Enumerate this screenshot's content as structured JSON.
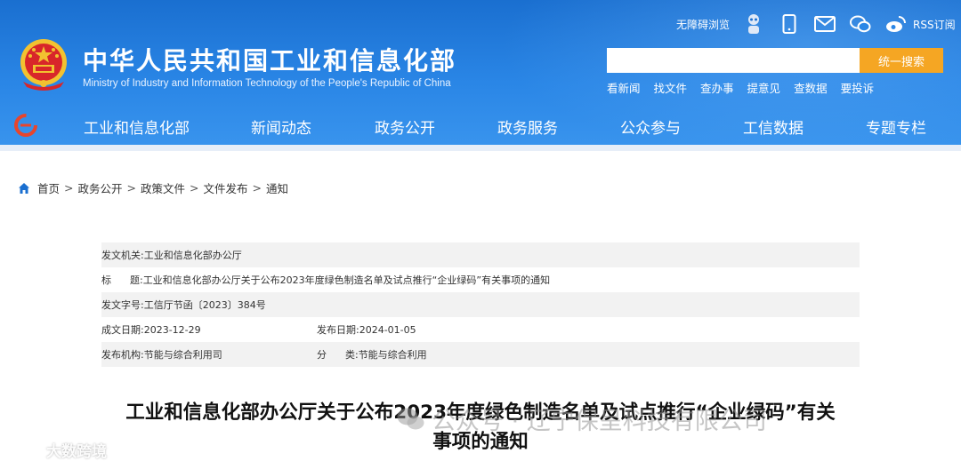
{
  "header": {
    "org_name_cn": "中华人民共和国工业和信息化部",
    "org_name_en": "Ministry of Industry and Information Technology of the People's Republic of China",
    "util": {
      "accessibility": "无障碍浏览",
      "rss": "RSS订阅"
    },
    "search": {
      "placeholder": "",
      "button": "统一搜索"
    },
    "quick_links": [
      "看新闻",
      "找文件",
      "查办事",
      "提意见",
      "查数据",
      "要投诉"
    ],
    "nav": [
      "工业和信息化部",
      "新闻动态",
      "政务公开",
      "政务服务",
      "公众参与",
      "工信数据",
      "专题专栏"
    ]
  },
  "breadcrumb": [
    "首页",
    "政务公开",
    "政策文件",
    "文件发布",
    "通知"
  ],
  "info": {
    "issuer_label": "发文机关:",
    "issuer": "工业和信息化部办公厅",
    "title_label": "标      题:",
    "title": "工业和信息化部办公厅关于公布2023年度绿色制造名单及试点推行“企业绿码”有关事项的通知",
    "doc_no_label": "发文字号:",
    "doc_no": "工信厅节函〔2023〕384号",
    "created_label": "成文日期:",
    "created": "2023-12-29",
    "published_label": "发布日期:",
    "published": "2024-01-05",
    "agency_label": "发布机构:",
    "agency": "节能与综合利用司",
    "category_label": "分      类:",
    "category": "节能与综合利用"
  },
  "article": {
    "title_line1": "工业和信息化部办公厅关于公布2023年度绿色制造名单及试点推行“企业绿码”有关",
    "title_line2": "事项的通知"
  },
  "watermarks": {
    "right": "公众号 · 辽宁保呈科技有限公司",
    "left": "大数跨境"
  },
  "colors": {
    "header_blue": "#2a86e6",
    "search_button": "#f5a623",
    "row_shade": "#f2f2f2"
  }
}
